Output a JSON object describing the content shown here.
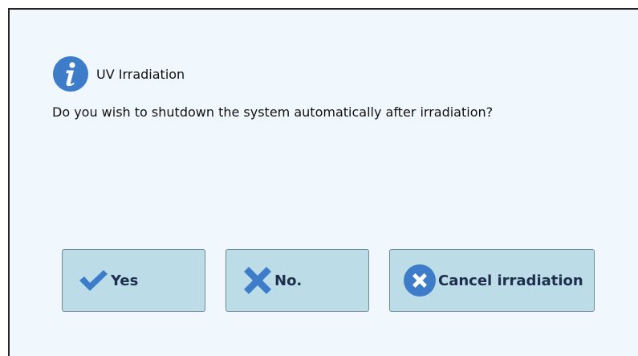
{
  "dialog": {
    "title": "UV Irradiation",
    "message": "Do you wish to shutdown the system automatically after irradiation?",
    "icon": "info-icon"
  },
  "buttons": {
    "yes": {
      "label": "Yes",
      "icon": "checkmark-icon"
    },
    "no": {
      "label": "No.",
      "icon": "x-icon"
    },
    "cancel": {
      "label": "Cancel irradiation",
      "icon": "cancel-circle-icon"
    }
  },
  "colors": {
    "dialog_background": "#f1f8fd",
    "button_background": "#bcdde8",
    "icon_blue": "#3d7cc9",
    "button_text": "#1f2e4d"
  }
}
